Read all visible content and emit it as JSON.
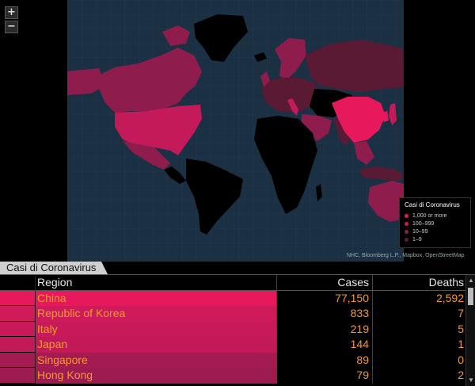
{
  "map": {
    "zoom_in_label": "+",
    "zoom_out_label": "−",
    "attribution": "NHC, Bloomberg L.P., Mapbox, OpenStreetMap",
    "colors": {
      "ocean": "#1b3042",
      "no_cases": "#000000",
      "tier_1000_plus": "#e8185c",
      "tier_100_999": "#c51a5a",
      "tier_10_99": "#8e1c4c",
      "tier_1_9": "#5a1a34"
    }
  },
  "legend": {
    "title": "Casi di Coronavirus",
    "items": [
      {
        "label": "1,000 or more",
        "color": "#e8185c"
      },
      {
        "label": "100–999",
        "color": "#c51a5a"
      },
      {
        "label": "10–99",
        "color": "#8e1c4c"
      },
      {
        "label": "1–9",
        "color": "#5a1a34"
      }
    ]
  },
  "table": {
    "tab_label": "Casi di Coronavirus",
    "headers": {
      "region": "Region",
      "cases": "Cases",
      "deaths": "Deaths"
    },
    "rows": [
      {
        "region": "China",
        "cases": "77,150",
        "deaths": "2,592",
        "color": "#e8185c"
      },
      {
        "region": "Republic of Korea",
        "cases": "833",
        "deaths": "7",
        "color": "#cf1a5c"
      },
      {
        "region": "Italy",
        "cases": "219",
        "deaths": "5",
        "color": "#c81a5a"
      },
      {
        "region": "Japan",
        "cases": "144",
        "deaths": "1",
        "color": "#c21a58"
      },
      {
        "region": "Singapore",
        "cases": "89",
        "deaths": "0",
        "color": "#a41b52"
      },
      {
        "region": "Hong Kong",
        "cases": "79",
        "deaths": "2",
        "color": "#9e1b50"
      }
    ]
  }
}
